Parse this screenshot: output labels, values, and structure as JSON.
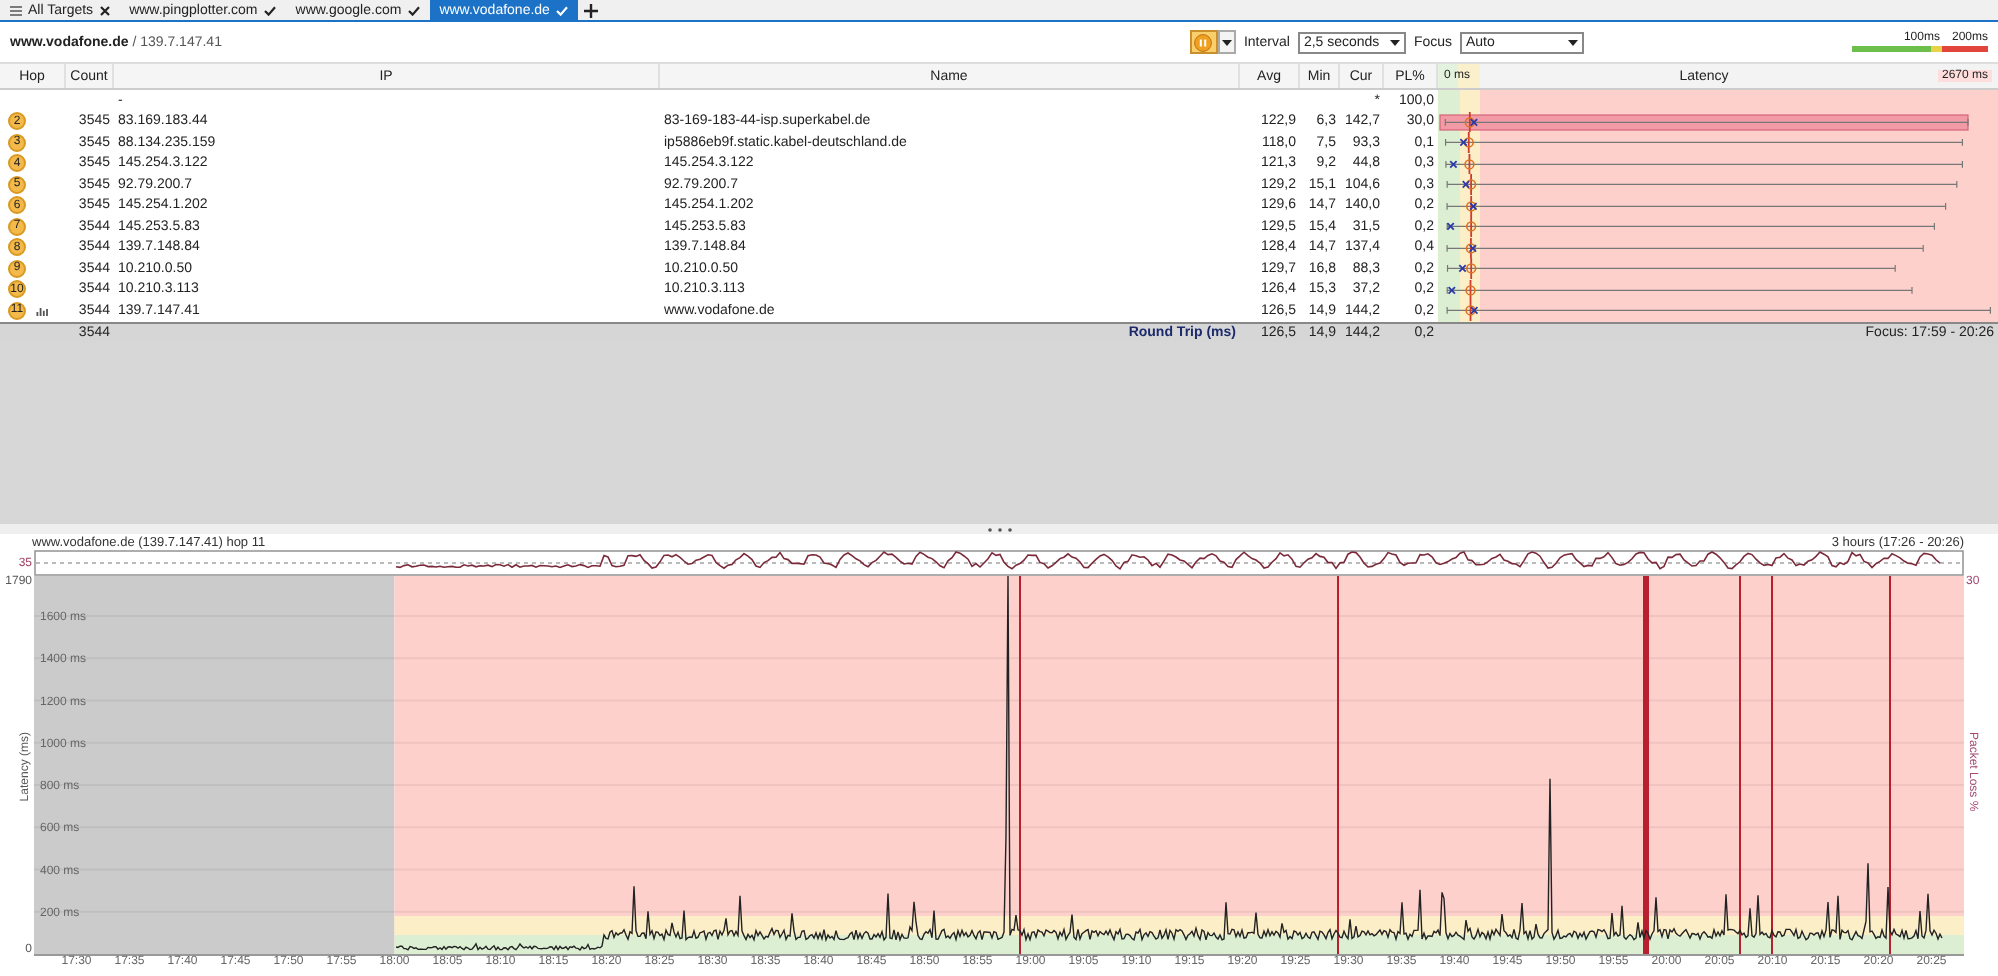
{
  "tabs": [
    {
      "label": "All Targets",
      "kind": "overview",
      "selected": false
    },
    {
      "label": "www.pingplotter.com",
      "kind": "target",
      "selected": false
    },
    {
      "label": "www.google.com",
      "kind": "target",
      "selected": false
    },
    {
      "label": "www.vodafone.de",
      "kind": "target",
      "selected": true
    }
  ],
  "toolbar": {
    "target": "**www.vodafone.de** / 139.7.147.41",
    "interval_label": "Interval",
    "interval": "2,5 seconds",
    "focus_label": "Focus",
    "focus": "Auto",
    "scale_labels": [
      "100ms",
      "200ms"
    ]
  },
  "table": {
    "columns": [
      "Hop",
      "Count",
      "IP",
      "Name",
      "Avg",
      "Min",
      "Cur",
      "PL%"
    ],
    "latency_header": {
      "min": "0 ms",
      "title": "Latency",
      "max": "2670 ms"
    },
    "rows": [
      {
        "ip": "-",
        "cur": "*",
        "pl": "100,0",
        "highlighted": false,
        "graphed": false
      },
      {
        "hop": "2",
        "count": "3545",
        "ip": "83.169.183.44",
        "name": "83-169-183-44-isp.superkabel.de",
        "avg": "122,9",
        "min": "6,3",
        "cur": "142,7",
        "pl": "30,0",
        "highlighted": true,
        "graphed": false,
        "level": 0.95
      },
      {
        "hop": "3",
        "count": "3545",
        "ip": "88.134.235.159",
        "name": "ip5886eb9f.static.kabel-deutschland.de",
        "avg": "118,0",
        "min": "7,5",
        "cur": "93,3",
        "pl": "0,1",
        "highlighted": false,
        "graphed": false,
        "level": 0.94
      },
      {
        "hop": "4",
        "count": "3545",
        "ip": "145.254.3.122",
        "name": "145.254.3.122",
        "avg": "121,3",
        "min": "9,2",
        "cur": "44,8",
        "pl": "0,3",
        "highlighted": false,
        "graphed": false,
        "level": 0.94
      },
      {
        "hop": "5",
        "count": "3545",
        "ip": "92.79.200.7",
        "name": "92.79.200.7",
        "avg": "129,2",
        "min": "15,1",
        "cur": "104,6",
        "pl": "0,3",
        "highlighted": false,
        "graphed": false,
        "level": 0.93
      },
      {
        "hop": "6",
        "count": "3545",
        "ip": "145.254.1.202",
        "name": "145.254.1.202",
        "avg": "129,6",
        "min": "14,7",
        "cur": "140,0",
        "pl": "0,2",
        "highlighted": false,
        "graphed": false,
        "level": 0.91
      },
      {
        "hop": "7",
        "count": "3544",
        "ip": "145.253.5.83",
        "name": "145.253.5.83",
        "avg": "129,5",
        "min": "15,4",
        "cur": "31,5",
        "pl": "0,2",
        "highlighted": false,
        "graphed": false,
        "level": 0.89
      },
      {
        "hop": "8",
        "count": "3544",
        "ip": "139.7.148.84",
        "name": "139.7.148.84",
        "avg": "128,4",
        "min": "14,7",
        "cur": "137,4",
        "pl": "0,4",
        "highlighted": false,
        "graphed": false,
        "level": 0.87
      },
      {
        "hop": "9",
        "count": "3544",
        "ip": "10.210.0.50",
        "name": "10.210.0.50",
        "avg": "129,7",
        "min": "16,8",
        "cur": "88,3",
        "pl": "0,2",
        "highlighted": false,
        "graphed": false,
        "level": 0.82
      },
      {
        "hop": "10",
        "count": "3544",
        "ip": "10.210.3.113",
        "name": "10.210.3.113",
        "avg": "126,4",
        "min": "15,3",
        "cur": "37,2",
        "pl": "0,2",
        "highlighted": false,
        "graphed": false,
        "level": 0.85
      },
      {
        "hop": "11",
        "count": "3544",
        "ip": "139.7.147.41",
        "name": "www.vodafone.de",
        "avg": "126,5",
        "min": "14,9",
        "cur": "144,2",
        "pl": "0,2",
        "highlighted": false,
        "graphed": true,
        "level": 0.99
      }
    ],
    "summary": {
      "count": "3544",
      "label": "Round Trip (ms)",
      "avg": "126,5",
      "min": "14,9",
      "cur": "144,2",
      "pl": "0,2",
      "focus": "Focus: 17:59 - 20:26"
    }
  },
  "graph": {
    "title": "www.vodafone.de (139.7.147.41) hop 11",
    "range": "3 hours (17:26 - 20:26)",
    "loss_scale": "35",
    "y_max": "1790",
    "y_min": "0",
    "loss_max": "30",
    "y_title": "Latency (ms)",
    "loss_title": "Packet Loss %",
    "grid_labels": [
      "1600 ms",
      "1400 ms",
      "1200 ms",
      "1000 ms",
      "800 ms",
      "600 ms",
      "400 ms",
      "200 ms"
    ],
    "x_labels": [
      "17:30",
      "17:35",
      "17:40",
      "17:45",
      "17:50",
      "17:55",
      "18:00",
      "18:05",
      "18:10",
      "18:15",
      "18:20",
      "18:25",
      "18:30",
      "18:35",
      "18:40",
      "18:45",
      "18:50",
      "18:55",
      "19:00",
      "19:05",
      "19:10",
      "19:15",
      "19:20",
      "19:25",
      "19:30",
      "19:35",
      "19:40",
      "19:45",
      "19:50",
      "19:55",
      "20:00",
      "20:05",
      "20:10",
      "20:15",
      "20:20",
      "20:25"
    ]
  }
}
